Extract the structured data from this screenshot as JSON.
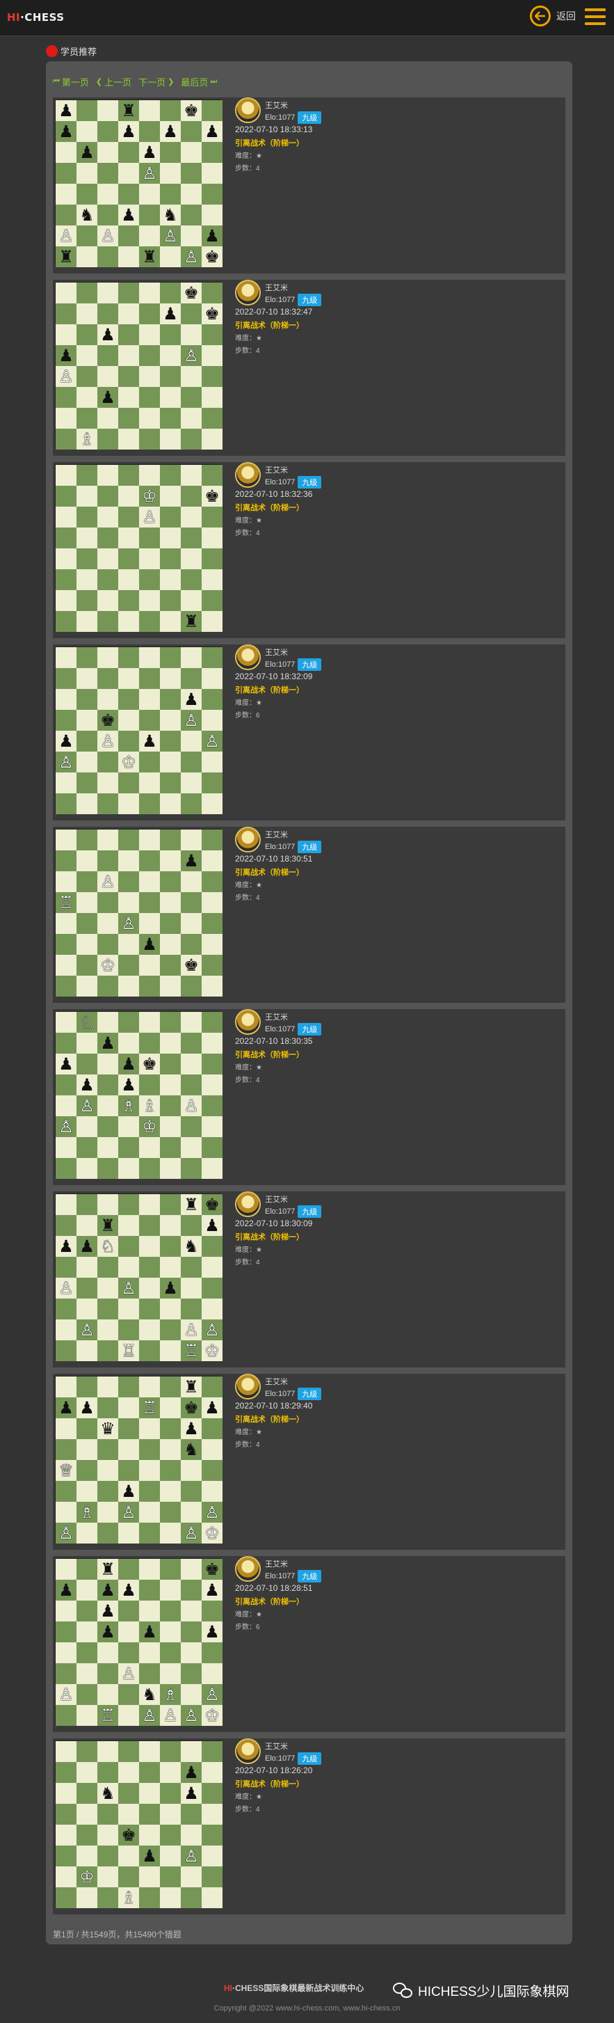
{
  "header": {
    "logo_hi": "HI",
    "logo_rest": "·CHESS",
    "back_label": "返回"
  },
  "section": {
    "title": "学员推荐"
  },
  "pager": {
    "first": "第一页",
    "prev": "上一页",
    "next": "下一页",
    "last": "最后页"
  },
  "puzzles": [
    {
      "name": "王艾米",
      "elo": "Elo:1077",
      "level": "九级",
      "time": "2022-07-10 18:33:13",
      "tactic": "引离战术（阶梯一）",
      "difficulty": "难度：★",
      "steps": "步数：4",
      "board": [
        "b..r..k.",
        "b..b.b.b",
        ".b..b...",
        "....w...",
        "........",
        ".n.b.n..",
        "w.w..w.b",
        "r...r.wk"
      ]
    },
    {
      "name": "王艾米",
      "elo": "Elo:1077",
      "level": "九级",
      "time": "2022-07-10 18:32:47",
      "tactic": "引离战术（阶梯一）",
      "difficulty": "难度：★",
      "steps": "步数：4",
      "board": [
        "......k.",
        ".....b.k",
        "..b.....",
        "b.....w.",
        "w.......",
        "..b.....",
        "........",
        ".B......"
      ]
    },
    {
      "name": "王艾米",
      "elo": "Elo:1077",
      "level": "九级",
      "time": "2022-07-10 18:32:36",
      "tactic": "引离战术（阶梯一）",
      "difficulty": "难度：★",
      "steps": "步数：4",
      "board": [
        "........",
        "....K..k",
        "....w...",
        "........",
        "........",
        "........",
        "........",
        "......r."
      ]
    },
    {
      "name": "王艾米",
      "elo": "Elo:1077",
      "level": "九级",
      "time": "2022-07-10 18:32:09",
      "tactic": "引离战术（阶梯一）",
      "difficulty": "难度：★",
      "steps": "步数：6",
      "board": [
        "........",
        "........",
        "......b.",
        "..k...w.",
        "b.w.b..w",
        "w..K....",
        "........",
        "........"
      ]
    },
    {
      "name": "王艾米",
      "elo": "Elo:1077",
      "level": "九级",
      "time": "2022-07-10 18:30:51",
      "tactic": "引离战术（阶梯一）",
      "difficulty": "难度：★",
      "steps": "步数：4",
      "board": [
        "........",
        "......b.",
        "..w.....",
        "R.......",
        "...w....",
        "....b...",
        "..K...k.",
        "........"
      ]
    },
    {
      "name": "王艾米",
      "elo": "Elo:1077",
      "level": "九级",
      "time": "2022-07-10 18:30:35",
      "tactic": "引离战术（阶梯一）",
      "difficulty": "难度：★",
      "steps": "步数：4",
      "board": [
        ".N......",
        "..b.....",
        "b..bk...",
        ".b.b....",
        ".w.BW.w.",
        "w...K...",
        "........",
        "........"
      ]
    },
    {
      "name": "王艾米",
      "elo": "Elo:1077",
      "level": "九级",
      "time": "2022-07-10 18:30:09",
      "tactic": "引离战术（阶梯一）",
      "difficulty": "难度：★",
      "steps": "步数：4",
      "board": [
        "......rk",
        "..r....b",
        "bbN...n.",
        "........",
        "w..w.b..",
        "........",
        ".w....ww",
        "...R..RK"
      ]
    },
    {
      "name": "王艾米",
      "elo": "Elo:1077",
      "level": "九级",
      "time": "2022-07-10 18:29:40",
      "tactic": "引离战术（阶梯一）",
      "difficulty": "难度：★",
      "steps": "步数：4",
      "board": [
        "......r.",
        "bb..R.kb",
        "..q...b.",
        "......n.",
        "Q.......",
        "...b....",
        ".B.w...w",
        "w.....wK"
      ]
    },
    {
      "name": "王艾米",
      "elo": "Elo:1077",
      "level": "九级",
      "time": "2022-07-10 18:28:51",
      "tactic": "引离战术（阶梯一）",
      "difficulty": "难度：★",
      "steps": "步数：6",
      "board": [
        "..r....k",
        "b.bb...b",
        "..b.....",
        "..b.b..b",
        "........",
        "...w....",
        "w...nB.w",
        "..R.wwwK"
      ]
    },
    {
      "name": "王艾米",
      "elo": "Elo:1077",
      "level": "九级",
      "time": "2022-07-10 18:26:20",
      "tactic": "引离战术（阶梯一）",
      "difficulty": "难度：★",
      "steps": "步数：4",
      "board": [
        "........",
        "......b.",
        "..n...b.",
        "........",
        "...k....",
        "....b.w.",
        ".K......",
        "...B...."
      ]
    }
  ],
  "footer": {
    "count_text": "第1页 / 共1549页，共15490个猎题",
    "brand_hi": "HI",
    "brand_text": "·CHESS国际象棋最新战术训练中心",
    "copyright": "Copyright @2022 www.hi-chess.com, www.hi-chess.cn",
    "wechat_label": "HICHESS少儿国际象棋网"
  }
}
